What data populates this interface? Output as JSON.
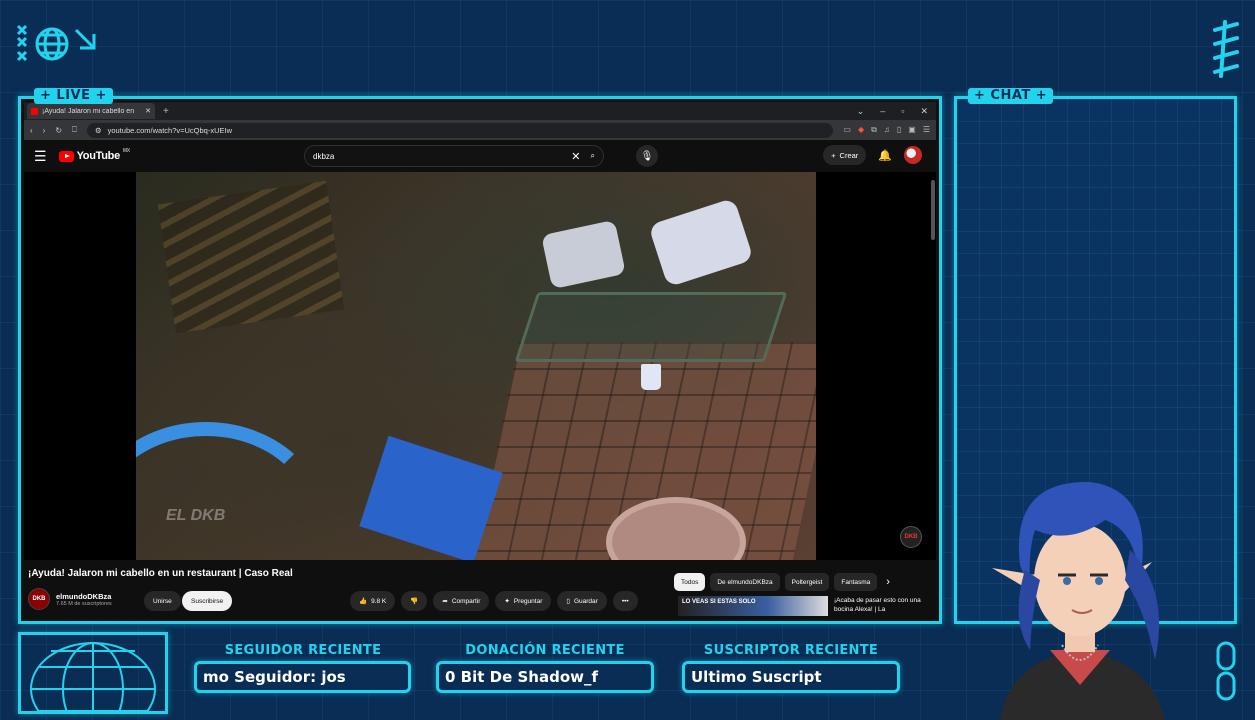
{
  "overlay": {
    "live_label": "+ LIVE +",
    "chat_label": "+ CHAT +",
    "accent": "#22d3ee",
    "background": "#0a2d55",
    "widgets": [
      {
        "title": "SEGUIDOR RECIENTE",
        "value": "mo Seguidor: jos"
      },
      {
        "title": "DONACIÓN RECIENTE",
        "value": "0 Bit De Shadow_f"
      },
      {
        "title": "SUSCRIPTOR RECIENTE",
        "value": "Ultimo Suscript"
      }
    ]
  },
  "browser": {
    "tab_title": "¡Ayuda! Jalaron mi cabello en",
    "url": "youtube.com/watch?v=UcQbq-xUEIw"
  },
  "youtube": {
    "logo": "YouTube",
    "country": "MX",
    "search_value": "dkbza",
    "create_label": "Crear",
    "video_title": "¡Ayuda! Jalaron mi cabello en un restaurant | Caso Real",
    "channel_name": "elmundoDKBza",
    "channel_subs": "7.65 M de suscriptores",
    "join_label": "Unirse",
    "subscribe_label": "Suscribirse",
    "likes": "9.8 K",
    "share_label": "Compartir",
    "ask_label": "Preguntar",
    "save_label": "Guardar",
    "watermark": "EL DKB",
    "badge": "DKB",
    "chips": [
      "Todos",
      "De elmundoDKBza",
      "Poltergeist",
      "Fantasma"
    ],
    "rec_thumb_text": "LO VEAS SI ESTAS SOLO",
    "rec_title": "¡Acaba de pasar esto con una bocina Alexa! | La"
  }
}
